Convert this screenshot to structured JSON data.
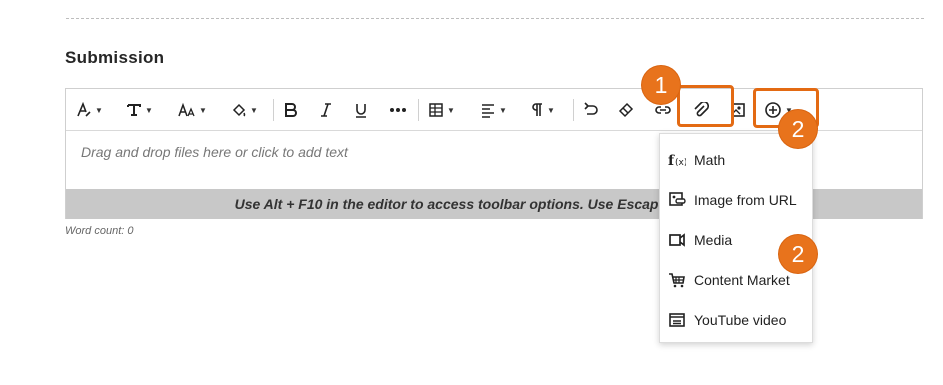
{
  "section": {
    "title": "Submission"
  },
  "editor": {
    "placeholder": "Drag and drop files here or click to add text",
    "hint": "Use Alt + F10 in the editor to access toolbar options. Use Escape to",
    "word_count": "Word count: 0"
  },
  "toolbar": {
    "buttons": [
      "paragraph-style-icon",
      "font-family-icon",
      "font-size-icon",
      "text-color-icon",
      "bold-icon",
      "italic-icon",
      "underline-icon",
      "more-icon",
      "table-icon",
      "align-icon",
      "paragraph-icon",
      "undo-icon",
      "eraser-icon",
      "link-icon",
      "attachment-icon",
      "image-icon",
      "add-content-icon"
    ]
  },
  "insert_menu": {
    "items": [
      {
        "label": "Math",
        "icon": "math-icon"
      },
      {
        "label": "Image from URL",
        "icon": "image-url-icon"
      },
      {
        "label": "Media",
        "icon": "media-icon"
      },
      {
        "label": "Content Market",
        "icon": "cart-icon"
      },
      {
        "label": "YouTube video",
        "icon": "youtube-icon"
      }
    ]
  },
  "annotations": {
    "badge1": "1",
    "badge2a": "2",
    "badge2b": "2",
    "accent": "#e8731c"
  }
}
